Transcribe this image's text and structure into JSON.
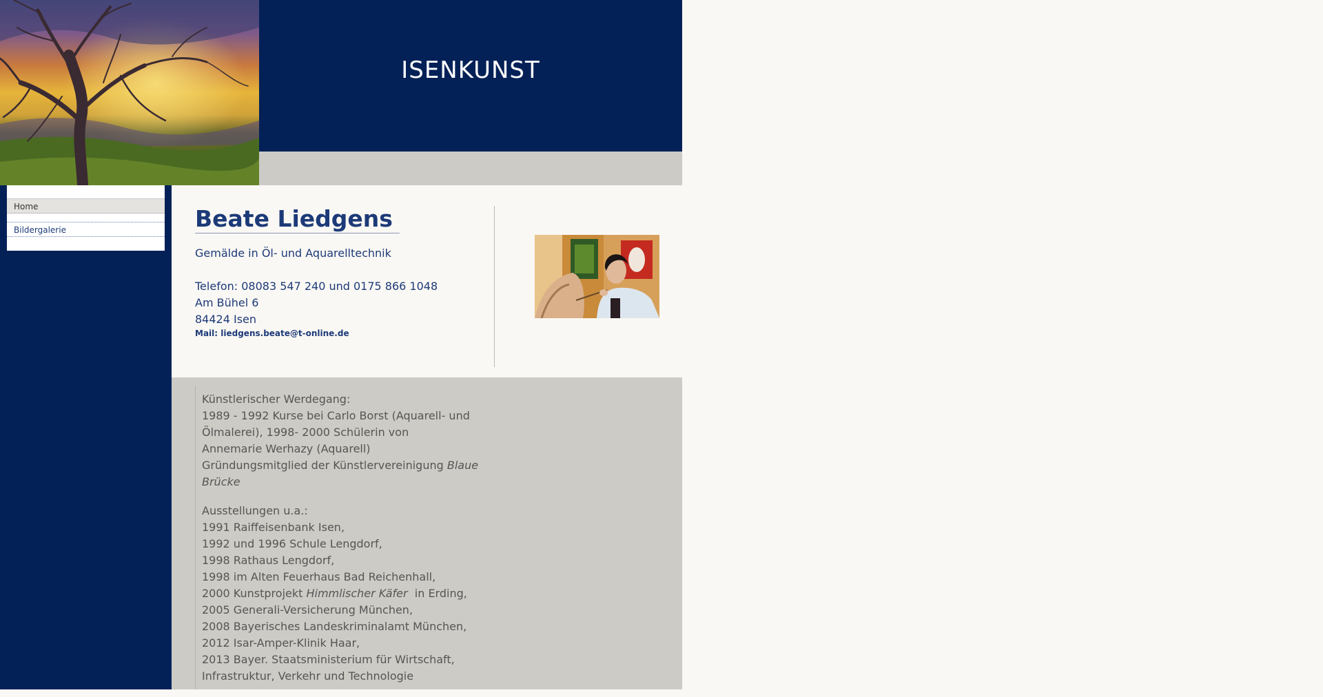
{
  "header": {
    "site_title": "ISENKUNST",
    "image_alt": "tree-sunset-painting"
  },
  "nav": {
    "items": [
      {
        "label": "Home",
        "active": true
      },
      {
        "label": "Bildergalerie",
        "active": false
      }
    ]
  },
  "intro": {
    "name": "Beate Liedgens",
    "subtitle": "Gemälde in Öl- und Aquarelltechnik",
    "phone": "Telefon: 08083 547 240 und 0175 866 1048",
    "street": "Am Bühel 6",
    "city": "84424 Isen",
    "mail_label": "Mail:",
    "mail_address": "liedgens.beate@t-online.de"
  },
  "bio": {
    "career_heading": "Künstlerischer Werdegang:",
    "career_line1": "1989 - 1992 Kurse bei Carlo Borst (Aquarell- und",
    "career_line2": "Ölmalerei), 1998- 2000 Schülerin von",
    "career_line3": "Annemarie Werhazy (Aquarell)",
    "career_line4_prefix": "Gründungsmitglied der Künstlervereinigung",
    "career_line4_italic": "Blaue",
    "career_line5_italic": "Brücke",
    "exhibitions_heading": "Ausstellungen u.a.:",
    "exh1": "1991 Raiffeisenbank Isen,",
    "exh2": "1992 und 1996 Schule Lengdorf,",
    "exh3": "1998 Rathaus Lengdorf,",
    "exh4": "1998 im Alten Feuerhaus Bad Reichenhall,",
    "exh5_prefix": "2000 Kunstprojekt",
    "exh5_italic": "Himmlischer Käfer",
    "exh5_suffix": "in Erding,",
    "exh6": "2005 Generali-Versicherung München,",
    "exh7": "2008 Bayerisches Landeskriminalamt München,",
    "exh8": "2012 Isar-Amper-Klinik Haar,",
    "exh9": "2013 Bayer. Staatsministerium für Wirtschaft,",
    "exh10": "Infrastruktur, Verkehr und Technologie"
  },
  "colors": {
    "navy": "#032157",
    "grey_band": "#cccbc5",
    "page_bg": "#faf8f4",
    "heading_blue": "#1d3a78"
  }
}
